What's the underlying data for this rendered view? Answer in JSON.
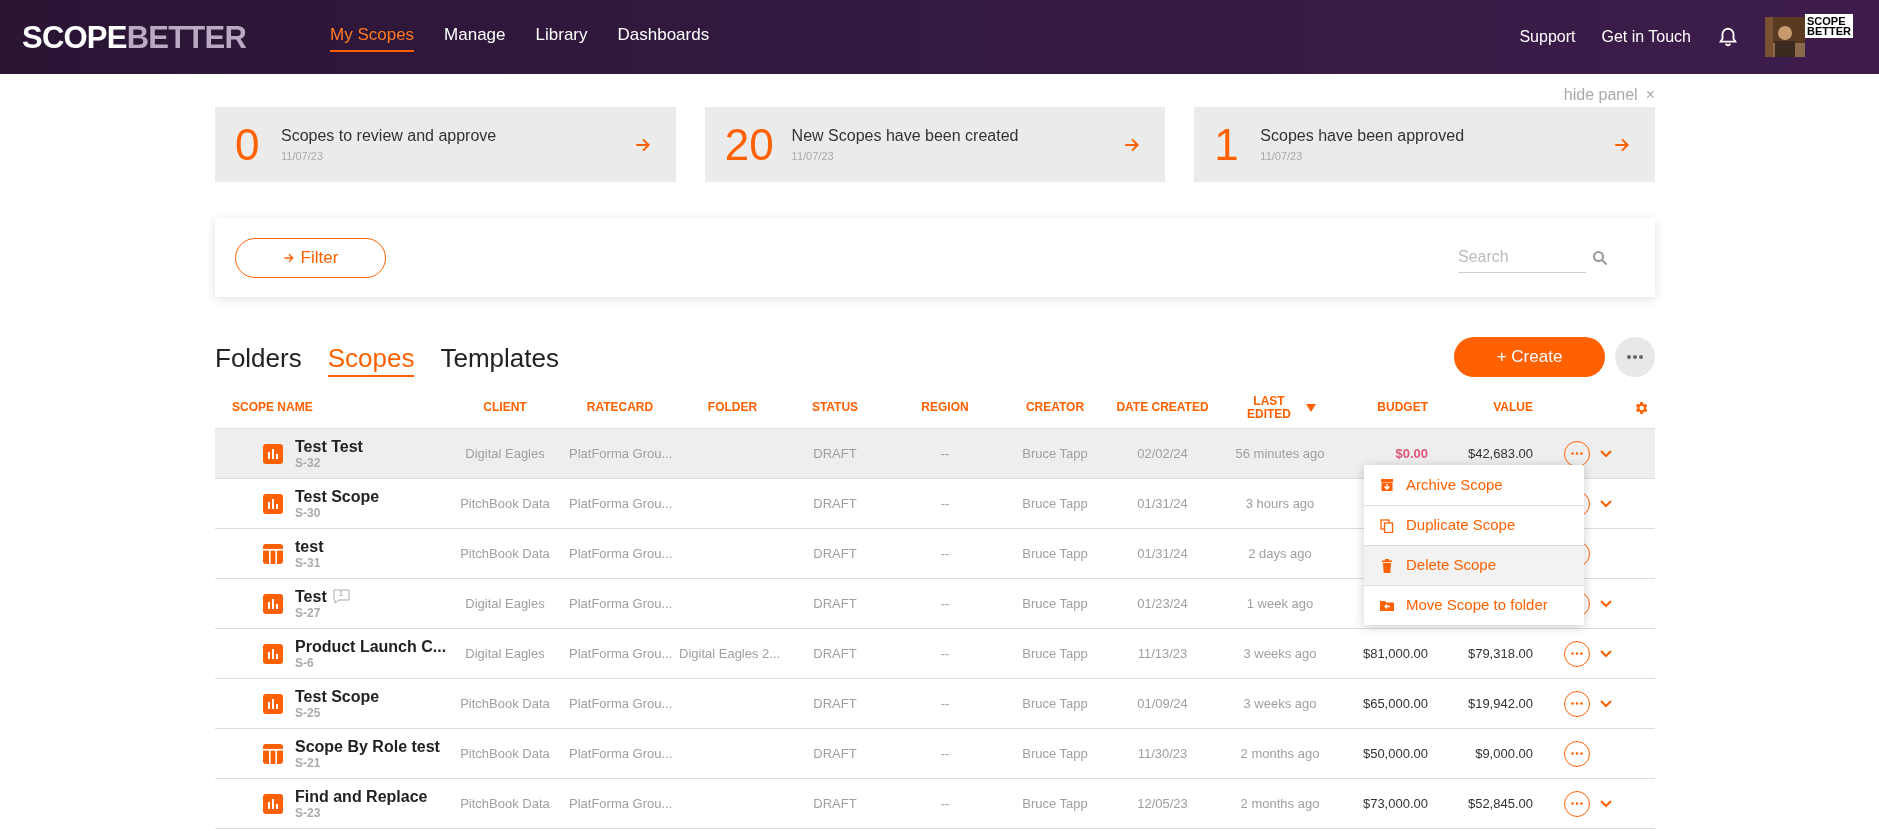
{
  "header": {
    "logo": {
      "part1": "SCOPE",
      "part2": "BETTER"
    },
    "nav": [
      {
        "label": "My Scopes",
        "selected": true
      },
      {
        "label": "Manage",
        "selected": false
      },
      {
        "label": "Library",
        "selected": false
      },
      {
        "label": "Dashboards",
        "selected": false
      }
    ],
    "links": [
      "Support",
      "Get in Touch"
    ],
    "org_logo": [
      "SCOPE",
      "BETTER"
    ]
  },
  "panel": {
    "hide_label": "hide panel",
    "close": "×",
    "cards": [
      {
        "count": "0",
        "label": "Scopes to review and approve",
        "date": "11/07/23"
      },
      {
        "count": "20",
        "label": "New Scopes have been created",
        "date": "11/07/23"
      },
      {
        "count": "1",
        "label": "Scopes have been approved",
        "date": "11/07/23"
      }
    ]
  },
  "toolbar": {
    "filter": "Filter",
    "search": {
      "placeholder": "Search"
    }
  },
  "tabs": [
    {
      "label": "Folders",
      "selected": false
    },
    {
      "label": "Scopes",
      "selected": true
    },
    {
      "label": "Templates",
      "selected": false
    }
  ],
  "create_button": "+ Create",
  "table": {
    "columns": [
      {
        "label": "SCOPE NAME",
        "sorted": false
      },
      {
        "label": "CLIENT",
        "sorted": false
      },
      {
        "label": "RATECARD",
        "sorted": false
      },
      {
        "label": "FOLDER",
        "sorted": false
      },
      {
        "label": "STATUS",
        "sorted": false
      },
      {
        "label": "REGION",
        "sorted": false
      },
      {
        "label": "CREATOR",
        "sorted": false
      },
      {
        "label": "DATE CREATED",
        "sorted": false
      },
      {
        "label": "LAST EDITED",
        "sorted": true
      },
      {
        "label": "BUDGET",
        "sorted": false
      },
      {
        "label": "VALUE",
        "sorted": false
      }
    ],
    "rows": [
      {
        "kind": "chart",
        "name": "Test Test",
        "code": "S-32",
        "client": "Digital Eagles",
        "ratecard": "PlatForma Grou...",
        "folder": "",
        "status": "DRAFT",
        "region": "--",
        "creator": "Bruce Tapp",
        "date_created": "02/02/24",
        "last_edited": "56 minutes ago",
        "budget": "$0.00",
        "over_budget": true,
        "value": "$42,683.00",
        "expandable": true,
        "selected": true
      },
      {
        "kind": "chart",
        "name": "Test Scope",
        "code": "S-30",
        "client": "PitchBook Data",
        "ratecard": "PlatForma Grou...",
        "folder": "",
        "status": "DRAFT",
        "region": "--",
        "creator": "Bruce Tapp",
        "date_created": "01/31/24",
        "last_edited": "3 hours ago",
        "expandable": true,
        "selected": false
      },
      {
        "kind": "table",
        "name": "test",
        "code": "S-31",
        "client": "PitchBook Data",
        "ratecard": "PlatForma Grou...",
        "folder": "",
        "status": "DRAFT",
        "region": "--",
        "creator": "Bruce Tapp",
        "date_created": "01/31/24",
        "last_edited": "2 days ago",
        "expandable": false,
        "selected": false
      },
      {
        "kind": "chart",
        "name": "Test",
        "comments": "1",
        "code": "S-27",
        "client": "Digital Eagles",
        "ratecard": "PlatForma Grou...",
        "folder": "",
        "status": "DRAFT",
        "region": "--",
        "creator": "Bruce Tapp",
        "date_created": "01/23/24",
        "last_edited": "1 week ago",
        "expandable": true,
        "selected": false
      },
      {
        "kind": "chart",
        "name": "Product Launch C...",
        "code": "S-6",
        "client": "Digital Eagles",
        "ratecard": "PlatForma Grou...",
        "folder": "Digital Eagles 2...",
        "status": "DRAFT",
        "region": "--",
        "creator": "Bruce Tapp",
        "date_created": "11/13/23",
        "last_edited": "3 weeks ago",
        "budget": "$81,000.00",
        "over_budget": false,
        "value": "$79,318.00",
        "expandable": true,
        "selected": false
      },
      {
        "kind": "chart",
        "name": "Test Scope",
        "code": "S-25",
        "client": "PitchBook Data",
        "ratecard": "PlatForma Grou...",
        "folder": "",
        "status": "DRAFT",
        "region": "--",
        "creator": "Bruce Tapp",
        "date_created": "01/09/24",
        "last_edited": "3 weeks ago",
        "budget": "$65,000.00",
        "over_budget": false,
        "value": "$19,942.00",
        "expandable": true,
        "selected": false
      },
      {
        "kind": "table",
        "name": "Scope By Role test",
        "code": "S-21",
        "client": "PitchBook Data",
        "ratecard": "PlatForma Grou...",
        "folder": "",
        "status": "DRAFT",
        "region": "--",
        "creator": "Bruce Tapp",
        "date_created": "11/30/23",
        "last_edited": "2 months ago",
        "budget": "$50,000.00",
        "over_budget": false,
        "value": "$9,000.00",
        "expandable": false,
        "selected": false
      },
      {
        "kind": "chart",
        "name": "Find and Replace",
        "code": "S-23",
        "client": "PitchBook Data",
        "ratecard": "PlatForma Grou...",
        "folder": "",
        "status": "DRAFT",
        "region": "--",
        "creator": "Bruce Tapp",
        "date_created": "12/05/23",
        "last_edited": "2 months ago",
        "budget": "$73,000.00",
        "over_budget": false,
        "value": "$52,845.00",
        "expandable": true,
        "selected": false
      }
    ]
  },
  "row_menu": [
    {
      "kind": "archive",
      "label": "Archive Scope",
      "selected": false
    },
    {
      "kind": "duplicate",
      "label": "Duplicate Scope",
      "selected": false
    },
    {
      "kind": "delete",
      "label": "Delete Scope",
      "selected": true
    },
    {
      "kind": "move",
      "label": "Move Scope to folder",
      "selected": false
    }
  ]
}
